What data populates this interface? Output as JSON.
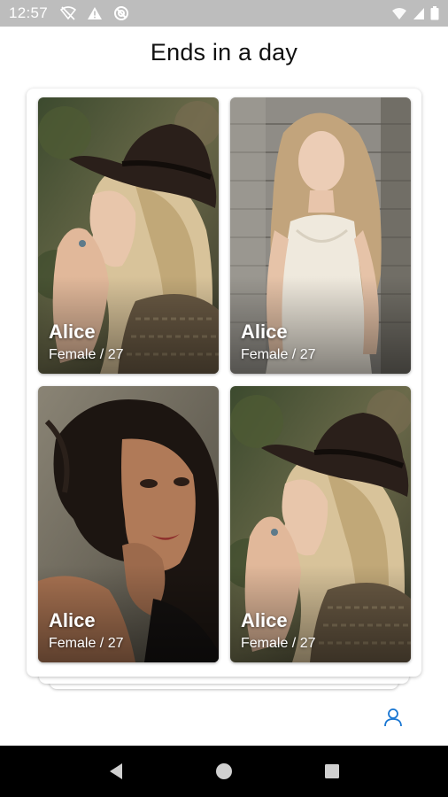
{
  "status_bar": {
    "time": "12:57",
    "left_icons": [
      "wifi-off-icon",
      "warning-icon",
      "do-not-disturb-icon"
    ],
    "right_icons": [
      "wifi-icon",
      "signal-icon",
      "battery-icon"
    ]
  },
  "header": {
    "title": "Ends in a day"
  },
  "profiles": [
    {
      "name": "Alice",
      "info": "Female / 27",
      "photo": "woman-black-hat"
    },
    {
      "name": "Alice",
      "info": "Female / 27",
      "photo": "woman-white-dress"
    },
    {
      "name": "Alice",
      "info": "Female / 27",
      "photo": "woman-dark-hair"
    },
    {
      "name": "Alice",
      "info": "Female / 27",
      "photo": "woman-black-hat"
    }
  ],
  "bottom": {
    "profile_icon": "person-icon",
    "accent_color": "#1976d2"
  },
  "nav_bar": {
    "buttons": [
      "back-icon",
      "home-icon",
      "recents-icon"
    ]
  }
}
